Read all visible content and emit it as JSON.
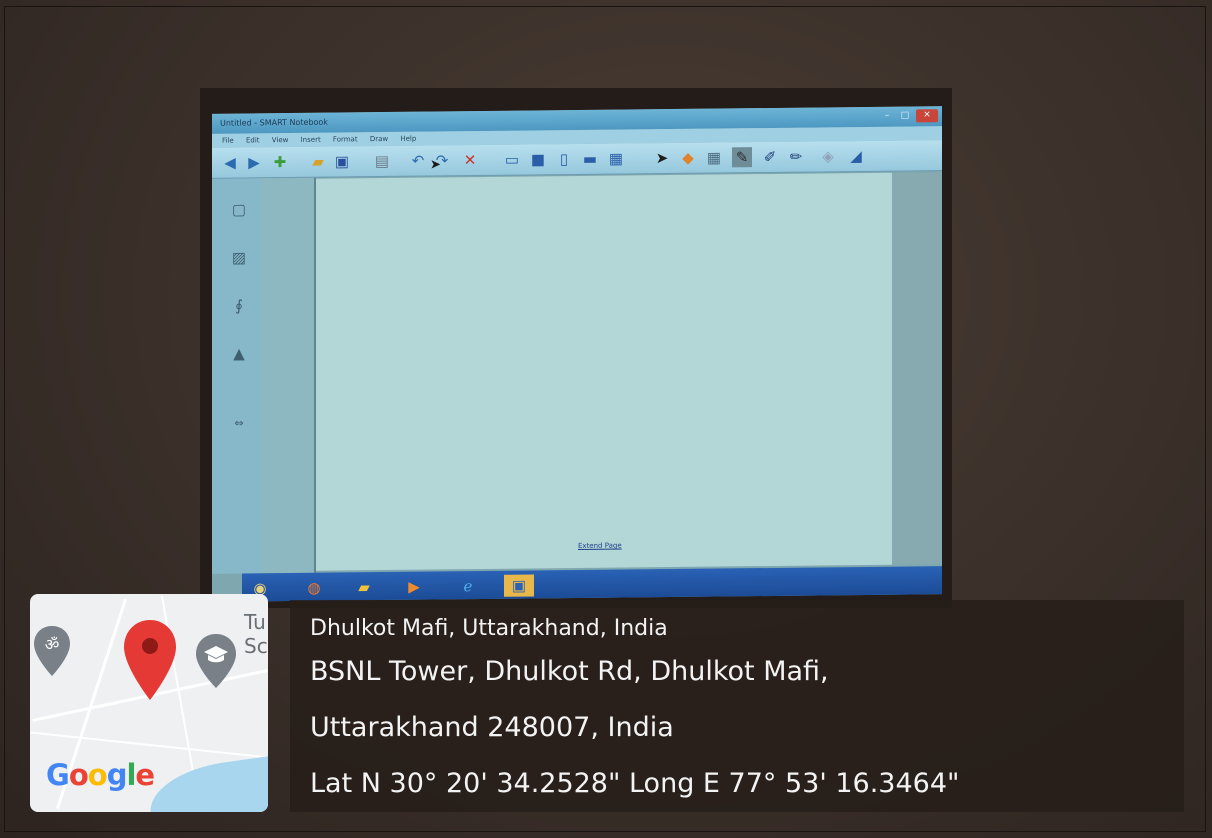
{
  "app": {
    "window_title": "Untitled - SMART Notebook",
    "menu": [
      "File",
      "Edit",
      "View",
      "Insert",
      "Format",
      "Draw",
      "Help"
    ],
    "extend_page_link": "Extend Page",
    "toolbar_icons": [
      "back-icon",
      "forward-icon",
      "add-page-icon",
      "open-folder-icon",
      "save-icon",
      "paste-icon",
      "undo-icon",
      "redo-icon",
      "delete-icon",
      "screen-shade-icon",
      "full-screen-icon",
      "dual-page-icon",
      "display-icon",
      "capture-icon",
      "select-icon",
      "shapes-icon",
      "table-icon",
      "pen-icon",
      "creative-pen-icon",
      "highlighter-icon",
      "eraser-icon",
      "fill-icon"
    ],
    "sidebar_icons": [
      "page-sorter-icon",
      "gallery-icon",
      "attachments-icon",
      "properties-icon"
    ],
    "taskbar_icons": [
      "start-icon",
      "firefox-icon",
      "folder-icon",
      "media-player-icon",
      "internet-explorer-icon",
      "smart-notebook-icon"
    ]
  },
  "geotag": {
    "place": "Dhulkot Mafi, Uttarakhand, India",
    "address_line1": "BSNL Tower, Dhulkot Rd, Dhulkot Mafi,",
    "address_line2": "Uttarakhand 248007, India",
    "coordinates": "Lat N 30° 20' 34.2528\" Long E 77° 53' 16.3464\"",
    "map": {
      "label_1": "Tu",
      "label_2": "Sc",
      "provider": "Google",
      "pins": [
        "location-pin-icon",
        "temple-pin-icon",
        "school-pin-icon"
      ]
    }
  },
  "colors": {
    "pin_red": "#e53935",
    "pin_gray": "#7a8088",
    "taskbar_blue": "#1b4a94"
  }
}
